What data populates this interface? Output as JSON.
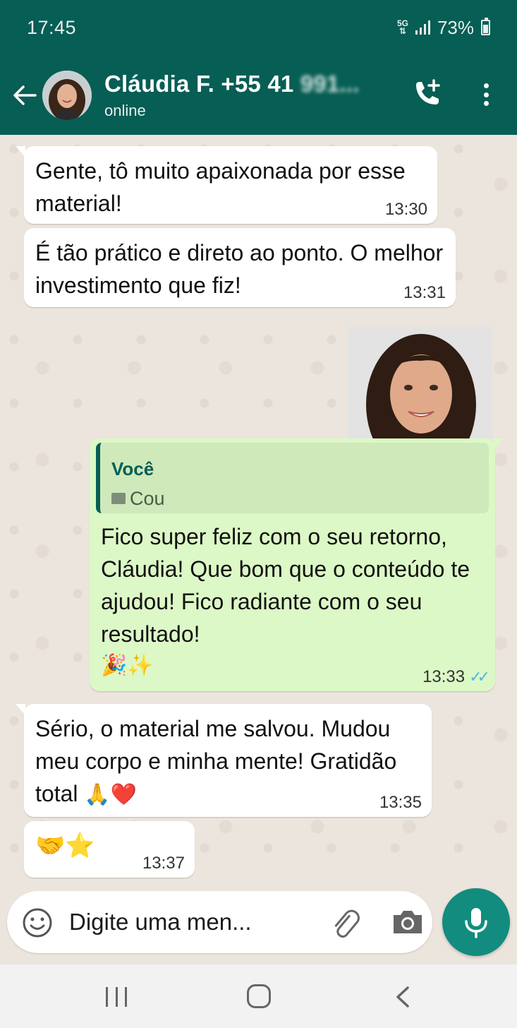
{
  "status_bar": {
    "time": "17:45",
    "network": "5G",
    "battery": "73%"
  },
  "header": {
    "contact_name": "Cláudia F. +55 41",
    "contact_number_blurred": "991...",
    "status": "online"
  },
  "messages": [
    {
      "direction": "in",
      "text": "Gente, tô muito apaixonada por esse material!",
      "time": "13:30"
    },
    {
      "direction": "in",
      "text": "É tão prático e direto ao ponto. O melhor investimento que fiz!",
      "time": "13:31"
    },
    {
      "direction": "out",
      "type": "image"
    },
    {
      "direction": "out",
      "quote": {
        "author": "Você",
        "text": "Cou"
      },
      "text": "Fico super feliz com o seu retorno, Cláudia! Que bom que o conteúdo te ajudou! Fico radiante com o seu resultado!",
      "emoji": "🎉✨",
      "time": "13:33",
      "read_ticks": "✓✓"
    },
    {
      "direction": "in",
      "text": "Sério, o material me salvou. Mudou meu corpo e minha mente! Gratidão total",
      "emoji": "🙏❤️",
      "time": "13:35"
    },
    {
      "direction": "in",
      "text": "",
      "emoji": "🤝⭐",
      "time": "13:37"
    }
  ],
  "input": {
    "placeholder": "Digite uma men..."
  },
  "colors": {
    "header": "#075e54",
    "outgoing_bubble": "#dcf8c6",
    "incoming_bubble": "#ffffff",
    "mic_button": "#128c7e",
    "read_ticks": "#4fb6ec"
  },
  "icons": [
    "back-arrow-icon",
    "add-call-icon",
    "more-vert-icon",
    "emoji-icon",
    "attach-clip-icon",
    "camera-icon",
    "mic-icon"
  ]
}
